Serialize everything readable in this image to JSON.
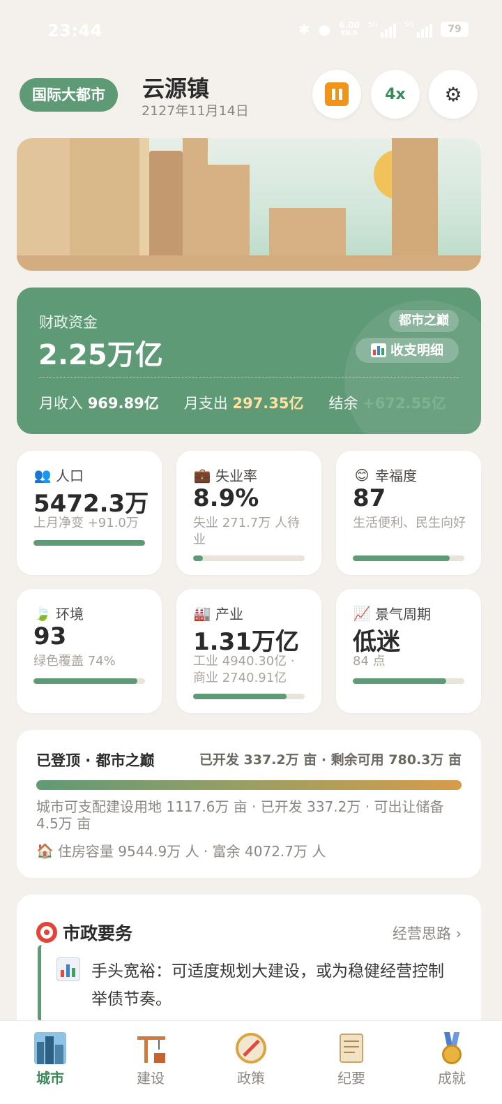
{
  "status_bar": {
    "time": "23:44",
    "net_speed": "6.00",
    "net_unit": "KB/S",
    "signal_label": "5G",
    "battery": "79"
  },
  "header": {
    "city_tier": "国际大都市",
    "town_name": "云源镇",
    "date": "2127年11月14日",
    "speed": "4x"
  },
  "finance": {
    "label": "财政资金",
    "value": "2.25万亿",
    "tag": "都市之巅",
    "detail_button": "收支明细",
    "income_label": "月收入",
    "income": "969.89亿",
    "expense_label": "月支出",
    "expense": "297.35亿",
    "balance_label": "结余",
    "balance": "+672.55亿"
  },
  "stats": {
    "population": {
      "label": "人口",
      "value": "5472.3万",
      "sub": "上月净变 +91.0万",
      "level": 1.0
    },
    "unemployment": {
      "label": "失业率",
      "value": "8.9%",
      "sub": "失业 271.7万 人待业",
      "level": 0.089
    },
    "happiness": {
      "label": "幸福度",
      "value": "87",
      "sub": "生活便利、民生向好",
      "level": 0.87
    },
    "environment": {
      "label": "环境",
      "value": "93",
      "sub": "绿色覆盖 74%",
      "level": 0.93
    },
    "industry": {
      "label": "产业",
      "value": "1.31万亿",
      "sub": "工业 4940.30亿 · 商业 2740.91亿",
      "level": 0.84
    },
    "cycle": {
      "label": "景气周期",
      "value": "低迷",
      "sub": "84 点",
      "level": 0.84
    }
  },
  "land": {
    "title": "已登顶 · 都市之巅",
    "summary": "已开发 337.2万 亩 · 剩余可用 780.3万 亩",
    "desc": "城市可支配建设用地 1117.6万 亩 · 已开发 337.2万 · 可出让储备 4.5万 亩",
    "housing": "住房容量 9544.9万 人 · 富余 4072.7万 人"
  },
  "affairs": {
    "title": "市政要务",
    "link": "经营思路 ›",
    "item": "手头宽裕：可适度规划大建设，或为稳健经营控制举债节奏。"
  },
  "tabs": [
    "城市",
    "建设",
    "政策",
    "纪要",
    "成就"
  ],
  "colors": {
    "accent": "#5f9a76",
    "pause": "#f0941a",
    "expense": "#ffe1a0",
    "background": "#f4f1ec"
  },
  "icons": {
    "population": "people-icon",
    "unemployment": "briefcase-icon",
    "happiness": "smile-icon",
    "environment": "leaf-icon",
    "industry": "factory-icon",
    "cycle": "trend-chart-icon"
  }
}
